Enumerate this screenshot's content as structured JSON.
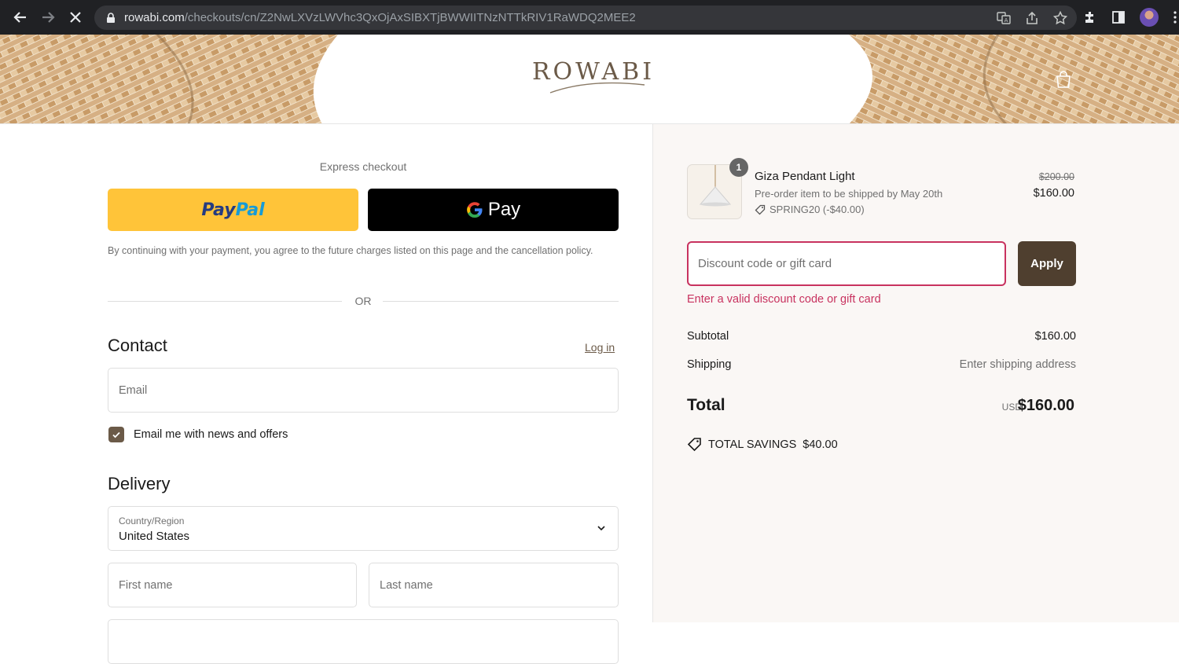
{
  "browser": {
    "url_host": "rowabi.com",
    "url_path": "/checkouts/cn/Z2NwLXVzLWVhc3QxOjAxSIBXTjBWWIITNzNTTkRIV1RaWDQ2MEE2"
  },
  "store": {
    "logo_text": "ROWABI"
  },
  "express": {
    "title": "Express checkout",
    "paypal_part1": "Pay",
    "paypal_part2": "Pal",
    "gpay_label": "Pay",
    "consent": "By continuing with your payment, you agree to the future charges listed on this page and the cancellation policy.",
    "or_label": "OR"
  },
  "contact": {
    "title": "Contact",
    "login_label": "Log in",
    "email_placeholder": "Email",
    "newsletter_label": "Email me with news and offers",
    "newsletter_checked": true
  },
  "delivery": {
    "title": "Delivery",
    "country_label": "Country/Region",
    "country_value": "United States",
    "first_name_placeholder": "First name",
    "last_name_placeholder": "Last name"
  },
  "order": {
    "item": {
      "quantity": "1",
      "name": "Giza Pendant Light",
      "note": "Pre-order item to be shipped by May 20th",
      "discount": "SPRING20 (-$40.00)",
      "price_original": "$200.00",
      "price_final": "$160.00"
    },
    "discount_placeholder": "Discount code or gift card",
    "apply_label": "Apply",
    "error_message": "Enter a valid discount code or gift card",
    "subtotal_label": "Subtotal",
    "subtotal_value": "$160.00",
    "shipping_label": "Shipping",
    "shipping_value": "Enter shipping address",
    "total_label": "Total",
    "total_currency": "USD",
    "total_value": "$160.00",
    "savings_label": "TOTAL SAVINGS",
    "savings_value": "$40.00"
  },
  "colors": {
    "accent": "#6b5a48",
    "apply_button": "#4f3f2f",
    "error": "#c8325f",
    "paypal_yellow": "#ffc439"
  }
}
